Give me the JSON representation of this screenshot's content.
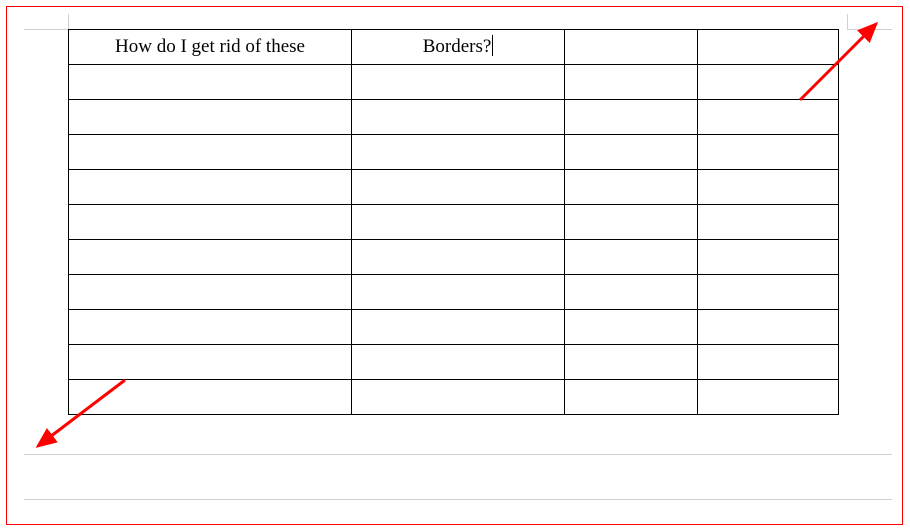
{
  "table": {
    "rows": 11,
    "cols": 4,
    "header": {
      "c1": "How do I get rid of these",
      "c2": "Borders?",
      "c3": "",
      "c4": ""
    }
  },
  "annotations": {
    "arrow_top_right": true,
    "arrow_bottom_left": true,
    "outer_highlight_color": "#f00"
  }
}
